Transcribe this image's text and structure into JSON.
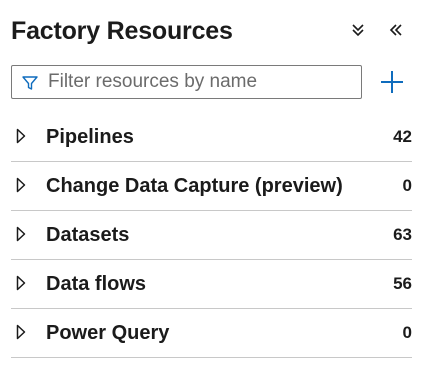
{
  "panel": {
    "title": "Factory Resources"
  },
  "header_actions": [
    {
      "name": "collapse-all",
      "icon": "double-chevron-down-icon"
    },
    {
      "name": "collapse-panel",
      "icon": "double-chevron-left-icon"
    }
  ],
  "filter": {
    "placeholder": "Filter resources by name",
    "value": "",
    "icon": "filter-icon"
  },
  "add_button": {
    "icon": "plus-icon",
    "color": "#0f6cbd"
  },
  "resources": [
    {
      "label": "Pipelines",
      "count": "42"
    },
    {
      "label": "Change Data Capture (preview)",
      "count": "0"
    },
    {
      "label": "Datasets",
      "count": "63"
    },
    {
      "label": "Data flows",
      "count": "56"
    },
    {
      "label": "Power Query",
      "count": "0"
    }
  ]
}
